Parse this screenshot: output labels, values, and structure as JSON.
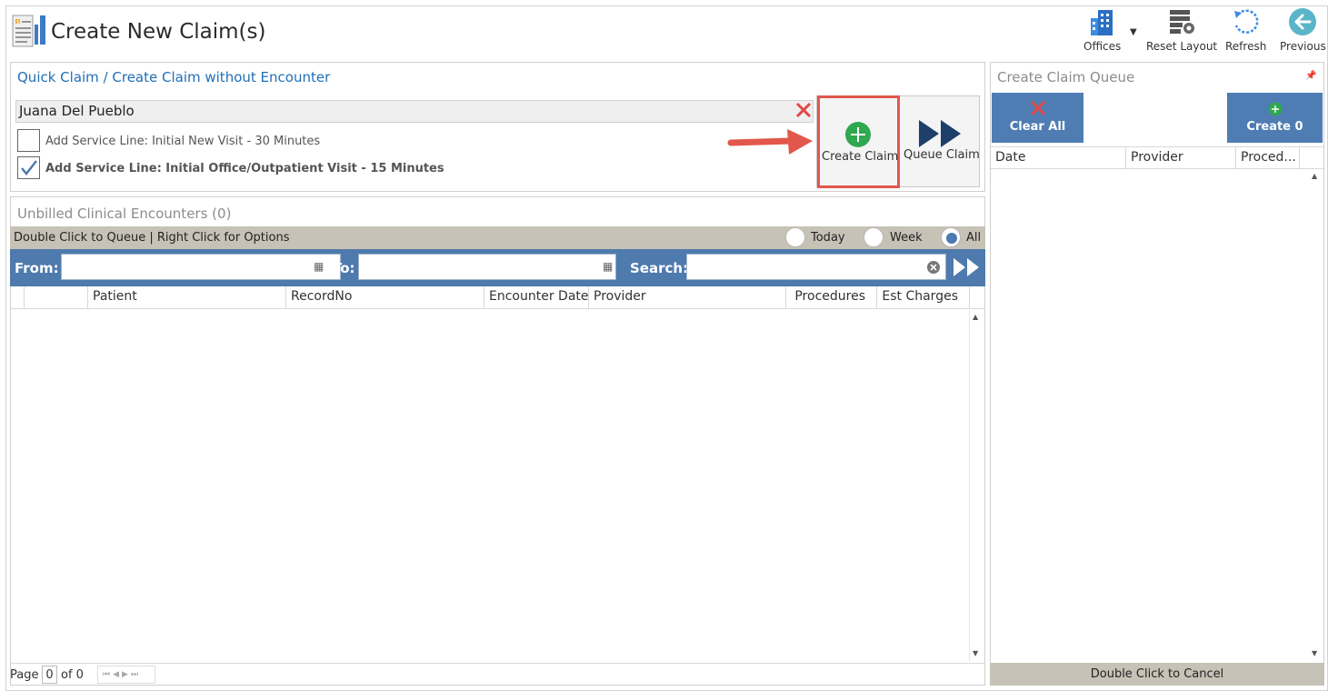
{
  "header": {
    "title": "Create New Claim(s)",
    "toolbar": {
      "offices": "Offices",
      "reset_layout": "Reset Layout",
      "refresh": "Refresh",
      "previous": "Previous"
    }
  },
  "quick_claim": {
    "title": "Quick Claim / Create Claim without Encounter",
    "patient_name": "Juana Del Pueblo",
    "service_lines": [
      {
        "label": "Add Service Line: Initial New Visit - 30 Minutes",
        "checked": false
      },
      {
        "label": "Add Service Line: Initial Office/Outpatient Visit - 15 Minutes",
        "checked": true
      }
    ],
    "create_claim_label": "Create Claim",
    "queue_claim_label": "Queue Claim"
  },
  "encounters": {
    "title": "Unbilled Clinical Encounters (0)",
    "hint": "Double Click to Queue | Right Click for Options",
    "filters": [
      "Today",
      "Week",
      "All"
    ],
    "selected_filter": "All",
    "from_label": "From:",
    "to_label": "To:",
    "search_label": "Search:",
    "from_value": "",
    "to_value": "",
    "search_value": "",
    "columns": [
      "Patient",
      "RecordNo",
      "Encounter Date",
      "Provider",
      "Procedures",
      "Est Charges"
    ],
    "rows": [],
    "pager": {
      "page_label": "Page",
      "page_value": "0",
      "of_label": "of 0"
    }
  },
  "queue": {
    "title": "Create Claim Queue",
    "clear_all_label": "Clear All",
    "create_label": "Create 0",
    "columns": [
      "Date",
      "Provider",
      "Proced..."
    ],
    "rows": [],
    "footer": "Double Click to Cancel"
  },
  "colors": {
    "accent_blue": "#4f7db3",
    "link_blue": "#1f6fb5",
    "add_green": "#2fa84f",
    "clear_red": "#e04848",
    "highlight_red": "#e2574c"
  }
}
